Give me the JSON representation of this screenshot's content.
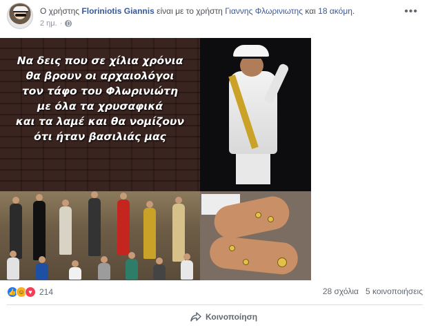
{
  "header": {
    "prefix": "Ο χρήστης",
    "author": "Floriniotis Giannis",
    "middle": "είναι με το χρήστη",
    "tagged": "Γιαννης Φλωρινιωτης",
    "joiner": "και",
    "others": "18 ακόμη",
    "suffix": ".",
    "time": "2 ημ.",
    "separator": "·",
    "privacy_icon": "globe-icon",
    "menu_icon": "more-options-icon",
    "menu_glyph": "•••"
  },
  "image": {
    "quote_lines": [
      "Να δεις που σε χίλια χρόνια",
      "θα βρουν οι αρχαιολόγοι",
      "τον τάφο του Φλωρινιώτη",
      "με όλα τα χρυσαφικά",
      "και τα λαμέ και θα νομίζουν",
      "ότι ήταν βασιλιάς μας"
    ]
  },
  "stats": {
    "reaction_icons": [
      "like-icon",
      "haha-icon",
      "love-icon"
    ],
    "reaction_count": "214",
    "comments": "28 σχόλια",
    "shares": "5 κοινοποιήσεις"
  },
  "actions": {
    "share_label": "Κοινοποίηση",
    "share_icon": "share-arrow-icon"
  },
  "colors": {
    "link": "#385898",
    "like": "#2078f4",
    "haha": "#f7b125",
    "love": "#f33e58"
  }
}
